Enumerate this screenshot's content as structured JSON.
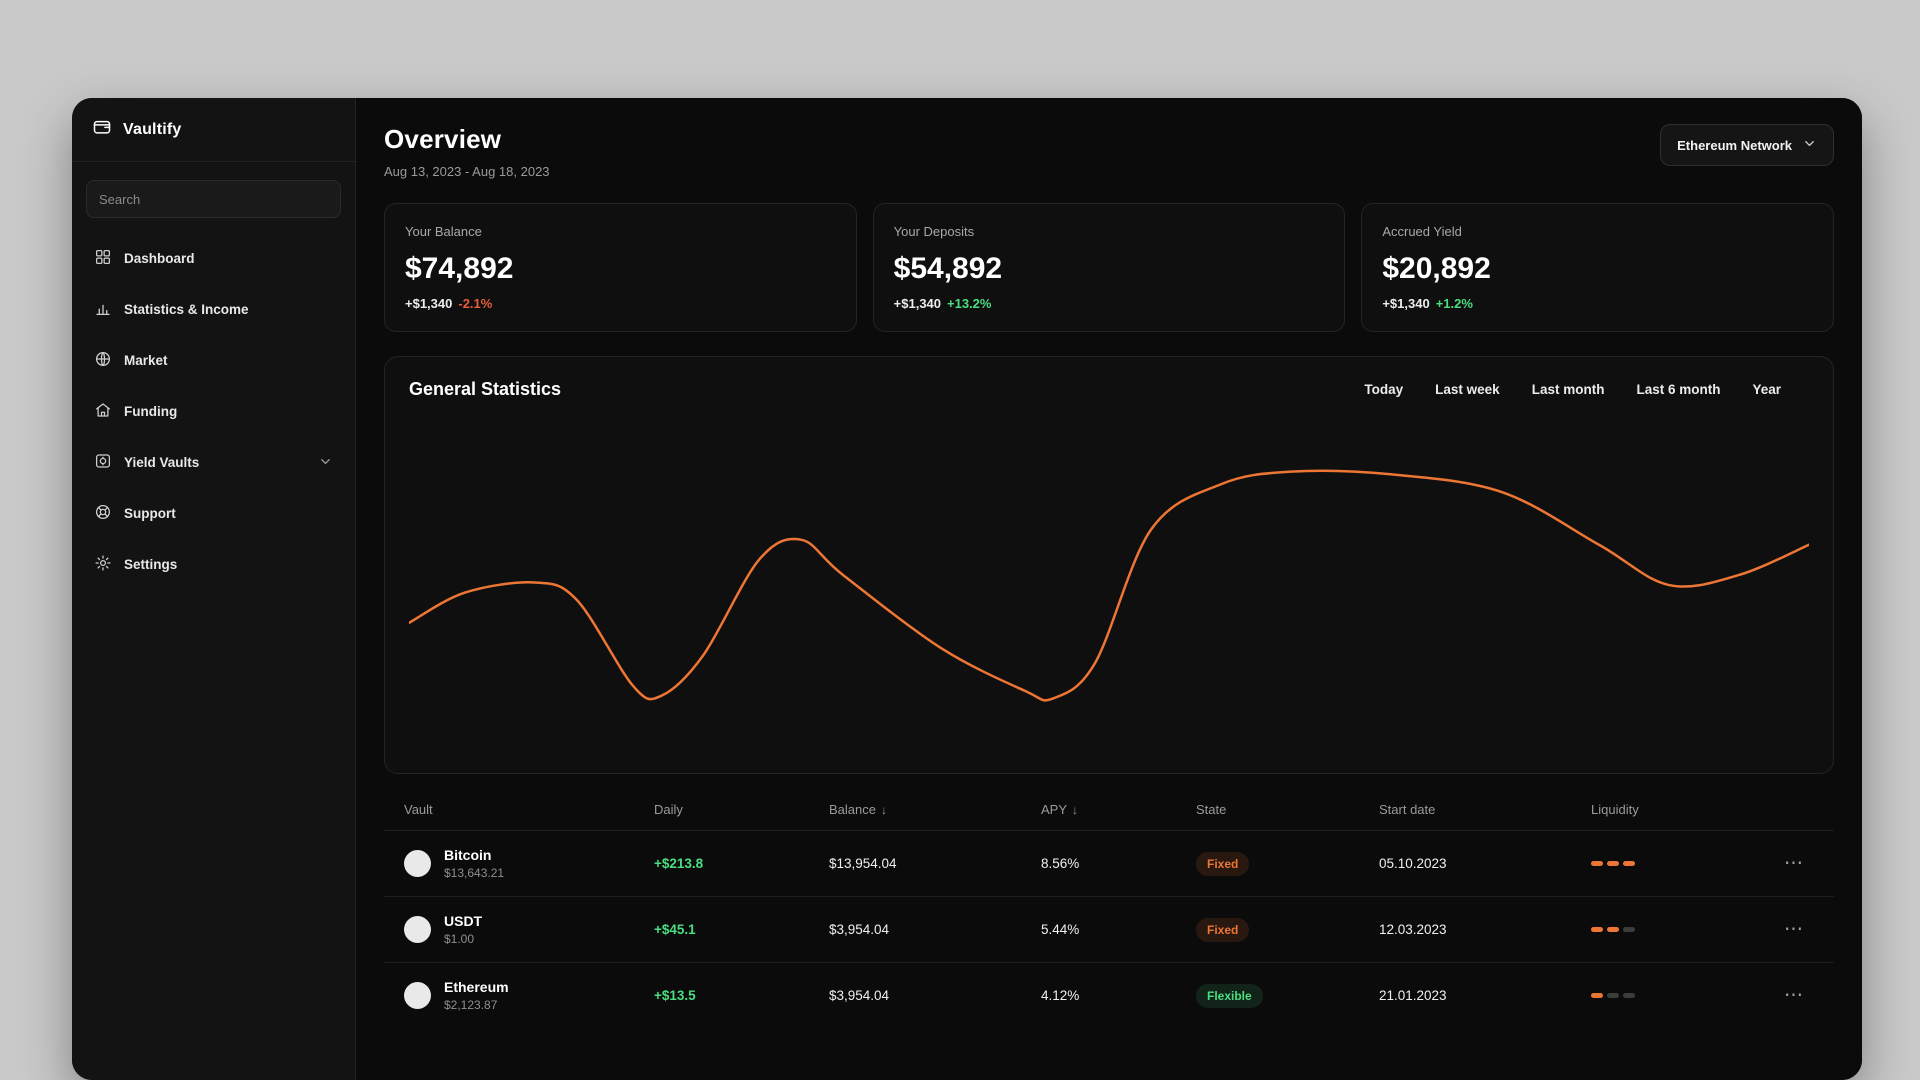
{
  "app": {
    "name": "Vaultify",
    "logo_icon": "wallet-icon"
  },
  "theme": {
    "outer_bg": "#c9c9c9",
    "window_bg": "#0b0b0b",
    "accent_orange": "#ED7635",
    "positive_green": "#4ade80",
    "negative_red": "#e85d3d"
  },
  "sidebar": {
    "search_placeholder": "Search",
    "items": [
      {
        "label": "Dashboard",
        "icon": "dashboard-grid-icon"
      },
      {
        "label": "Statistics & Income",
        "icon": "bar-chart-icon"
      },
      {
        "label": "Market",
        "icon": "globe-icon"
      },
      {
        "label": "Funding",
        "icon": "home-icon"
      },
      {
        "label": "Yield Vaults",
        "icon": "vault-icon",
        "has_chevron": true
      },
      {
        "label": "Support",
        "icon": "lifebuoy-icon"
      },
      {
        "label": "Settings",
        "icon": "gear-icon"
      }
    ]
  },
  "header": {
    "title": "Overview",
    "date_range": "Aug 13, 2023 - Aug 18, 2023",
    "network": "Ethereum Network",
    "network_icon": "chevron-down-icon"
  },
  "stats": [
    {
      "label": "Your Balance",
      "value": "$74,892",
      "delta": "+$1,340",
      "change": "-2.1%",
      "change_direction": "down"
    },
    {
      "label": "Your Deposits",
      "value": "$54,892",
      "delta": "+$1,340",
      "change": "+13.2%",
      "change_direction": "up"
    },
    {
      "label": "Accrued Yield",
      "value": "$20,892",
      "delta": "+$1,340",
      "change": "+1.2%",
      "change_direction": "up"
    }
  ],
  "chart_panel": {
    "title": "General Statistics",
    "filters": [
      "Today",
      "Last week",
      "Last month",
      "Last 6 month",
      "Year"
    ]
  },
  "chart_data": {
    "type": "line",
    "title": "General Statistics",
    "axes_visible": false,
    "grid": false,
    "legend": false,
    "x_range": [
      0,
      100
    ],
    "y_range": [
      0,
      100
    ],
    "series": [
      {
        "name": "portfolio-value",
        "color": "#ED7635",
        "x": [
          0,
          4,
          9,
          12,
          16,
          18,
          21,
          25,
          28,
          31,
          38,
          44,
          46,
          49,
          53,
          58,
          63,
          70,
          78,
          85,
          90,
          95,
          100
        ],
        "y": [
          33,
          45,
          49,
          42,
          8,
          4,
          20,
          58,
          66,
          52,
          23,
          6,
          3,
          17,
          70,
          88,
          93,
          92,
          85,
          64,
          48,
          52,
          64
        ]
      }
    ]
  },
  "table": {
    "headers": [
      {
        "label": "Vault"
      },
      {
        "label": "Daily"
      },
      {
        "label": "Balance",
        "sort": "↓"
      },
      {
        "label": "APY",
        "sort": "↓"
      },
      {
        "label": "State"
      },
      {
        "label": "Start date"
      },
      {
        "label": "Liquidity"
      }
    ],
    "row_menu": "⋯",
    "rows": [
      {
        "name": "Bitcoin",
        "price": "$13,643.21",
        "daily": "+$213.8",
        "balance": "$13,954.04",
        "apy": "8.56%",
        "state": "Fixed",
        "start_date": "05.10.2023",
        "liquidity": {
          "filled": 3,
          "total": 3
        }
      },
      {
        "name": "USDT",
        "price": "$1.00",
        "daily": "+$45.1",
        "balance": "$3,954.04",
        "apy": "5.44%",
        "state": "Fixed",
        "start_date": "12.03.2023",
        "liquidity": {
          "filled": 2,
          "total": 3
        }
      },
      {
        "name": "Ethereum",
        "price": "$2,123.87",
        "daily": "+$13.5",
        "balance": "$3,954.04",
        "apy": "4.12%",
        "state": "Flexible",
        "start_date": "21.01.2023",
        "liquidity": {
          "filled": 1,
          "total": 3
        }
      }
    ]
  }
}
